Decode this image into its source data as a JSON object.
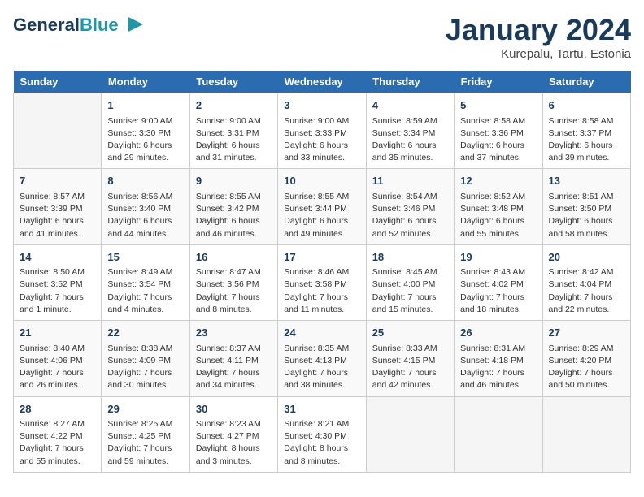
{
  "header": {
    "logo_line1": "General",
    "logo_line2": "Blue",
    "month_title": "January 2024",
    "location": "Kurepalu, Tartu, Estonia"
  },
  "days_of_week": [
    "Sunday",
    "Monday",
    "Tuesday",
    "Wednesday",
    "Thursday",
    "Friday",
    "Saturday"
  ],
  "weeks": [
    [
      {
        "day": "",
        "sunrise": "",
        "sunset": "",
        "daylight": ""
      },
      {
        "day": "1",
        "sunrise": "Sunrise: 9:00 AM",
        "sunset": "Sunset: 3:30 PM",
        "daylight": "Daylight: 6 hours and 29 minutes."
      },
      {
        "day": "2",
        "sunrise": "Sunrise: 9:00 AM",
        "sunset": "Sunset: 3:31 PM",
        "daylight": "Daylight: 6 hours and 31 minutes."
      },
      {
        "day": "3",
        "sunrise": "Sunrise: 9:00 AM",
        "sunset": "Sunset: 3:33 PM",
        "daylight": "Daylight: 6 hours and 33 minutes."
      },
      {
        "day": "4",
        "sunrise": "Sunrise: 8:59 AM",
        "sunset": "Sunset: 3:34 PM",
        "daylight": "Daylight: 6 hours and 35 minutes."
      },
      {
        "day": "5",
        "sunrise": "Sunrise: 8:58 AM",
        "sunset": "Sunset: 3:36 PM",
        "daylight": "Daylight: 6 hours and 37 minutes."
      },
      {
        "day": "6",
        "sunrise": "Sunrise: 8:58 AM",
        "sunset": "Sunset: 3:37 PM",
        "daylight": "Daylight: 6 hours and 39 minutes."
      }
    ],
    [
      {
        "day": "7",
        "sunrise": "Sunrise: 8:57 AM",
        "sunset": "Sunset: 3:39 PM",
        "daylight": "Daylight: 6 hours and 41 minutes."
      },
      {
        "day": "8",
        "sunrise": "Sunrise: 8:56 AM",
        "sunset": "Sunset: 3:40 PM",
        "daylight": "Daylight: 6 hours and 44 minutes."
      },
      {
        "day": "9",
        "sunrise": "Sunrise: 8:55 AM",
        "sunset": "Sunset: 3:42 PM",
        "daylight": "Daylight: 6 hours and 46 minutes."
      },
      {
        "day": "10",
        "sunrise": "Sunrise: 8:55 AM",
        "sunset": "Sunset: 3:44 PM",
        "daylight": "Daylight: 6 hours and 49 minutes."
      },
      {
        "day": "11",
        "sunrise": "Sunrise: 8:54 AM",
        "sunset": "Sunset: 3:46 PM",
        "daylight": "Daylight: 6 hours and 52 minutes."
      },
      {
        "day": "12",
        "sunrise": "Sunrise: 8:52 AM",
        "sunset": "Sunset: 3:48 PM",
        "daylight": "Daylight: 6 hours and 55 minutes."
      },
      {
        "day": "13",
        "sunrise": "Sunrise: 8:51 AM",
        "sunset": "Sunset: 3:50 PM",
        "daylight": "Daylight: 6 hours and 58 minutes."
      }
    ],
    [
      {
        "day": "14",
        "sunrise": "Sunrise: 8:50 AM",
        "sunset": "Sunset: 3:52 PM",
        "daylight": "Daylight: 7 hours and 1 minute."
      },
      {
        "day": "15",
        "sunrise": "Sunrise: 8:49 AM",
        "sunset": "Sunset: 3:54 PM",
        "daylight": "Daylight: 7 hours and 4 minutes."
      },
      {
        "day": "16",
        "sunrise": "Sunrise: 8:47 AM",
        "sunset": "Sunset: 3:56 PM",
        "daylight": "Daylight: 7 hours and 8 minutes."
      },
      {
        "day": "17",
        "sunrise": "Sunrise: 8:46 AM",
        "sunset": "Sunset: 3:58 PM",
        "daylight": "Daylight: 7 hours and 11 minutes."
      },
      {
        "day": "18",
        "sunrise": "Sunrise: 8:45 AM",
        "sunset": "Sunset: 4:00 PM",
        "daylight": "Daylight: 7 hours and 15 minutes."
      },
      {
        "day": "19",
        "sunrise": "Sunrise: 8:43 AM",
        "sunset": "Sunset: 4:02 PM",
        "daylight": "Daylight: 7 hours and 18 minutes."
      },
      {
        "day": "20",
        "sunrise": "Sunrise: 8:42 AM",
        "sunset": "Sunset: 4:04 PM",
        "daylight": "Daylight: 7 hours and 22 minutes."
      }
    ],
    [
      {
        "day": "21",
        "sunrise": "Sunrise: 8:40 AM",
        "sunset": "Sunset: 4:06 PM",
        "daylight": "Daylight: 7 hours and 26 minutes."
      },
      {
        "day": "22",
        "sunrise": "Sunrise: 8:38 AM",
        "sunset": "Sunset: 4:09 PM",
        "daylight": "Daylight: 7 hours and 30 minutes."
      },
      {
        "day": "23",
        "sunrise": "Sunrise: 8:37 AM",
        "sunset": "Sunset: 4:11 PM",
        "daylight": "Daylight: 7 hours and 34 minutes."
      },
      {
        "day": "24",
        "sunrise": "Sunrise: 8:35 AM",
        "sunset": "Sunset: 4:13 PM",
        "daylight": "Daylight: 7 hours and 38 minutes."
      },
      {
        "day": "25",
        "sunrise": "Sunrise: 8:33 AM",
        "sunset": "Sunset: 4:15 PM",
        "daylight": "Daylight: 7 hours and 42 minutes."
      },
      {
        "day": "26",
        "sunrise": "Sunrise: 8:31 AM",
        "sunset": "Sunset: 4:18 PM",
        "daylight": "Daylight: 7 hours and 46 minutes."
      },
      {
        "day": "27",
        "sunrise": "Sunrise: 8:29 AM",
        "sunset": "Sunset: 4:20 PM",
        "daylight": "Daylight: 7 hours and 50 minutes."
      }
    ],
    [
      {
        "day": "28",
        "sunrise": "Sunrise: 8:27 AM",
        "sunset": "Sunset: 4:22 PM",
        "daylight": "Daylight: 7 hours and 55 minutes."
      },
      {
        "day": "29",
        "sunrise": "Sunrise: 8:25 AM",
        "sunset": "Sunset: 4:25 PM",
        "daylight": "Daylight: 7 hours and 59 minutes."
      },
      {
        "day": "30",
        "sunrise": "Sunrise: 8:23 AM",
        "sunset": "Sunset: 4:27 PM",
        "daylight": "Daylight: 8 hours and 3 minutes."
      },
      {
        "day": "31",
        "sunrise": "Sunrise: 8:21 AM",
        "sunset": "Sunset: 4:30 PM",
        "daylight": "Daylight: 8 hours and 8 minutes."
      },
      {
        "day": "",
        "sunrise": "",
        "sunset": "",
        "daylight": ""
      },
      {
        "day": "",
        "sunrise": "",
        "sunset": "",
        "daylight": ""
      },
      {
        "day": "",
        "sunrise": "",
        "sunset": "",
        "daylight": ""
      }
    ]
  ]
}
